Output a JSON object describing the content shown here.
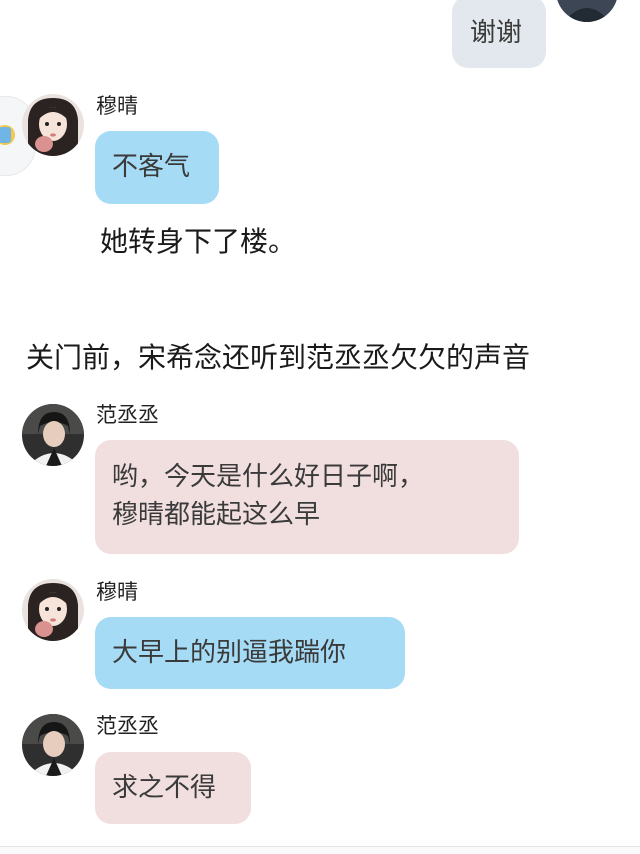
{
  "messages": {
    "m1": {
      "text": "谢谢"
    },
    "m2": {
      "name": "穆晴",
      "text": "不客气"
    },
    "narration1": "她转身下了楼。",
    "narration2": "关门前，宋希念还听到范丞丞欠欠的声音",
    "m3": {
      "name": "范丞丞",
      "line1": "哟，今天是什么好日子啊，",
      "line2": "穆晴都能起这么早"
    },
    "m4": {
      "name": "穆晴",
      "text": "大早上的别逼我踹你"
    },
    "m5": {
      "name": "范丞丞",
      "text": "求之不得"
    }
  },
  "colors": {
    "bubble_blue": "#a6dbf5",
    "bubble_pink": "#f1dfe0",
    "bubble_grey": "#e3e8ee"
  }
}
